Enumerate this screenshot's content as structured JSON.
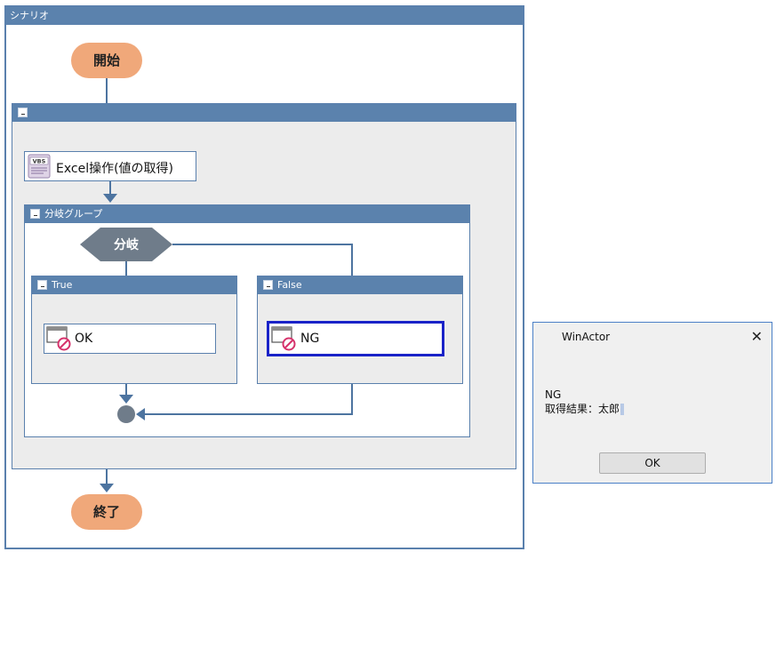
{
  "scenario": {
    "title": "シナリオ",
    "start_label": "開始",
    "end_label": "終了",
    "outer_group_label": "",
    "excel_node": {
      "label": "Excel操作(値の取得)",
      "icon": "vbs-script-icon",
      "icon_text": "VBS"
    },
    "branch_group": {
      "title": "分岐グループ",
      "decision_label": "分岐",
      "true_panel": {
        "title": "True",
        "node_label": "OK",
        "icon": "message-box-icon"
      },
      "false_panel": {
        "title": "False",
        "node_label": "NG",
        "icon": "message-box-icon"
      }
    }
  },
  "dialog": {
    "title": "WinActor",
    "close_glyph": "✕",
    "message_line1": "NG",
    "message_line2": "取得結果：太郎",
    "ok_label": "OK"
  },
  "colors": {
    "accent": "#5b82ad",
    "terminal": "#f0a87a",
    "decision": "#6f7c8a",
    "selected_border": "#1a23c8",
    "prohibit": "#d6336c"
  }
}
